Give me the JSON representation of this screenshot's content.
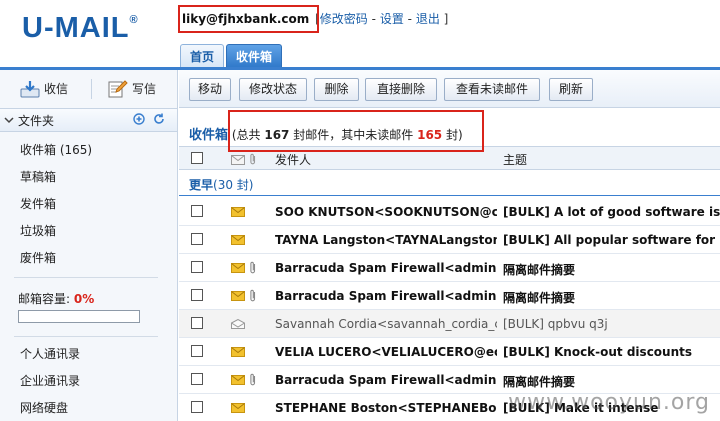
{
  "header": {
    "logo": "U-MAIL",
    "logo_mark": "®",
    "user": "liky@fjhxbank.com",
    "bracket_open": "[",
    "bracket_close": "]",
    "separator": "-",
    "links": {
      "change_password": "修改密码",
      "settings": "设置",
      "logout": "退出"
    }
  },
  "tabs": [
    {
      "label": "首页",
      "active": false
    },
    {
      "label": "收件箱",
      "active": true
    }
  ],
  "sidebar": {
    "receive_label": "收信",
    "compose_label": "写信",
    "folder_header": "文件夹",
    "folders": [
      {
        "label": "收件箱 (165)"
      },
      {
        "label": "草稿箱"
      },
      {
        "label": "发件箱"
      },
      {
        "label": "垃圾箱"
      },
      {
        "label": "废件箱"
      }
    ],
    "quota_label": "邮箱容量:",
    "quota_value": "0%",
    "quota_fraction": 0.0,
    "extras": [
      {
        "label": "个人通讯录"
      },
      {
        "label": "企业通讯录"
      },
      {
        "label": "网络硬盘"
      }
    ]
  },
  "toolbar": {
    "buttons": [
      "移动",
      "修改状态",
      "删除",
      "直接删除",
      "查看未读邮件",
      "刷新"
    ]
  },
  "inbox": {
    "title": "收件箱",
    "summary_prefix": "(总共",
    "total": "167",
    "summary_middle": "封邮件，其中未读邮件",
    "unread": "165",
    "summary_suffix": "封)",
    "col_sender": "发件人",
    "col_subject": "主题",
    "group_label": "更早",
    "group_count": "(30 封)"
  },
  "messages": [
    {
      "sender": "SOO KNUTSON<SOOKNUTSON@cavteleco",
      "subject": "[BULK] A lot of good software is in different",
      "unread": true,
      "attachment": false
    },
    {
      "sender": "TAYNA Langston<TAYNALangston@ferguson",
      "subject": "[BULK] All popular software for PC and Mac",
      "unread": true,
      "attachment": false
    },
    {
      "sender": "Barracuda Spam Firewall<admin@fuzhou",
      "subject": "隔离邮件摘要",
      "unread": true,
      "attachment": true
    },
    {
      "sender": "Barracuda Spam Firewall<admin@fuzhou",
      "subject": "隔离邮件摘要",
      "unread": true,
      "attachment": true
    },
    {
      "sender": "Savannah Cordia<savannah_cordia_cc@",
      "subject": "[BULK] qpbvu q3j",
      "unread": false,
      "attachment": false
    },
    {
      "sender": "VELIA LUCERO<VELIALUCERO@eckellsparks",
      "subject": "[BULK] Knock-out discounts",
      "unread": true,
      "attachment": false
    },
    {
      "sender": "Barracuda Spam Firewall<admin@fuzhou",
      "subject": "隔离邮件摘要",
      "unread": true,
      "attachment": true
    },
    {
      "sender": "STEPHANE Boston<STEPHANEBoston@",
      "subject": "[BULK] Make it intense",
      "unread": true,
      "attachment": false
    }
  ],
  "watermark": "www.wooyun.org",
  "colors": {
    "accent": "#1a5ea8",
    "tab_active": "#2f78c9",
    "highlight_red": "#d9241b",
    "envelope": "#f2c12e"
  }
}
